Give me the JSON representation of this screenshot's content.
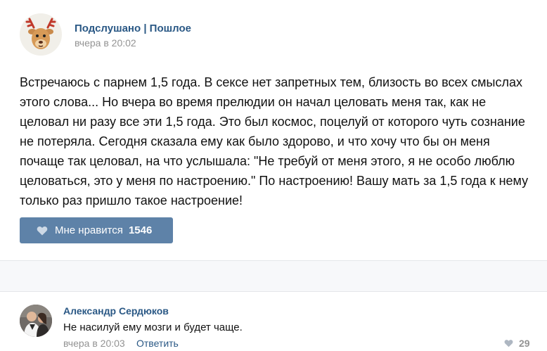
{
  "post": {
    "author": "Подслушано | Пошлое",
    "date": "вчера в 20:02",
    "text": "Встречаюсь с парнем 1,5 года. В сексе нет запретных тем, близость во всех смыслах\nэтого слова... Но вчера во время прелюдии он начал целовать меня так, как не\nцеловал ни разу все эти 1,5 года. Это был космос, поцелуй от которого чуть сознание\nне потеряла. Сегодня сказала ему как было здорово, и что хочу что бы он меня\nпочаще так целовал, на что услышала: \"Не требуй от меня этого, я не особо люблю\nцеловаться, это у меня по настроению.\" По настроению! Вашу мать за 1,5 года к нему\nтолько раз пришло такое настроение!",
    "like_label": "Мне нравится",
    "like_count": "1546",
    "avatar_icon": "deer-icon"
  },
  "comment": {
    "author": "Александр Сердюков",
    "text": "Не насилуй ему мозги и будет чаще.",
    "date": "вчера в 20:03",
    "reply_label": "Ответить",
    "like_count": "29"
  },
  "colors": {
    "link": "#2a5885",
    "like_button": "#5e82a8",
    "muted": "#939393"
  }
}
